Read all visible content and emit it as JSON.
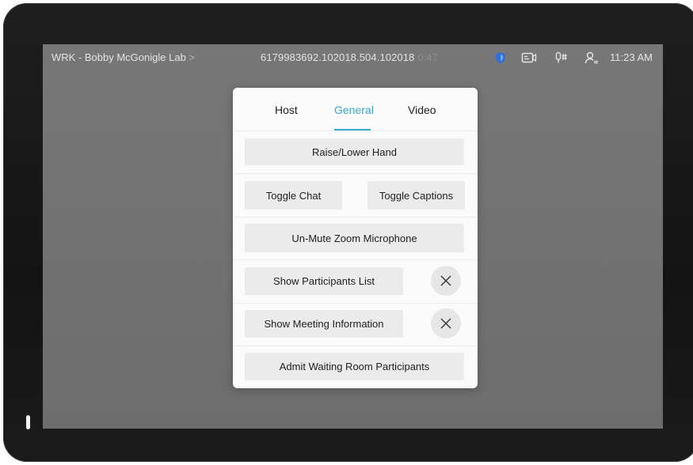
{
  "status_bar": {
    "room_name": "WRK - Bobby McGonigle Lab",
    "room_chevron": ">",
    "meeting_uri": "6179983692.102018.504.102018",
    "call_timer": "0:47",
    "icons": [
      "shield-icon",
      "self-view-icon",
      "microphone-icon",
      "participants-icon"
    ],
    "clock": "11:23 AM"
  },
  "panel": {
    "tabs": [
      {
        "label": "Host",
        "active": false
      },
      {
        "label": "General",
        "active": true
      },
      {
        "label": "Video",
        "active": false
      }
    ],
    "buttons": {
      "raise_hand": "Raise/Lower Hand",
      "toggle_chat": "Toggle Chat",
      "toggle_captions": "Toggle Captions",
      "unmute_zoom_mic": "Un-Mute Zoom Microphone",
      "show_participants": "Show Participants List",
      "show_meeting_info": "Show Meeting Information",
      "admit_waiting_room": "Admit Waiting Room Participants"
    }
  },
  "colors": {
    "accent": "#3aa8c9",
    "shield": "#2f6fd6",
    "screen_bg": "#737373",
    "button_bg": "#ebebeb"
  }
}
